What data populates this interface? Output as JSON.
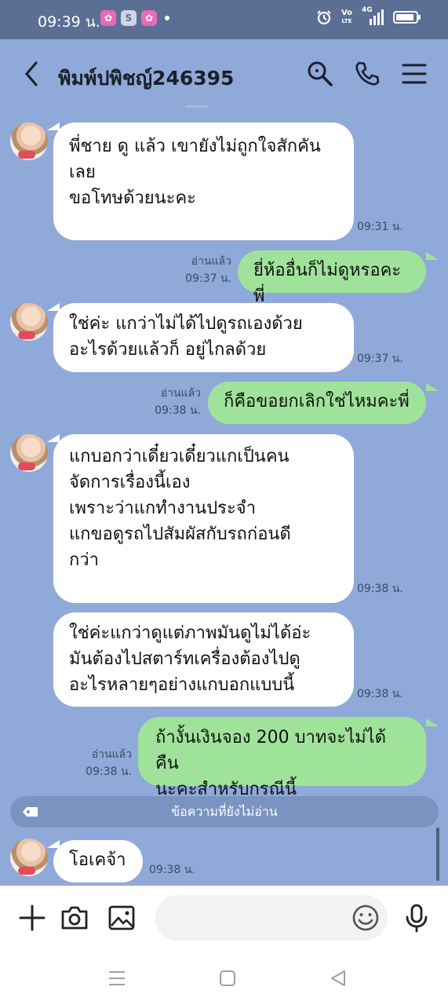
{
  "status": {
    "time": "09:39 น.",
    "app_icon_s": "S",
    "net_vo": "Vo",
    "net_lte": "LTE",
    "net_4g": "4G"
  },
  "header": {
    "title": "พิมพ์ปพิชญ์246395"
  },
  "messages": [
    {
      "dir": "in",
      "text": "พี่ชาย ดู แล้ว เขายังไม่ถูกใจสักคัน\nเลย\nขอโทษด้วยนะคะ",
      "time": "09:31 น."
    },
    {
      "dir": "out",
      "text": "ยี่ห้ออื่นก็ไม่ดูหรอคะพี่",
      "read": "อ่านแล้ว",
      "time": "09:37 น."
    },
    {
      "dir": "in",
      "text": "ใช่ค่ะ แกว่าไม่ได้ไปดูรถเองด้วย\nอะไรด้วยแล้วก็ อยู่ไกลด้วย",
      "time": "09:37 น."
    },
    {
      "dir": "out",
      "text": "ก็คือขอยกเลิกใช่ไหมคะพี่",
      "read": "อ่านแล้ว",
      "time": "09:38 น."
    },
    {
      "dir": "in",
      "text": "แกบอกว่าเดี๋ยวเดี๋ยวแกเป็นคน\nจัดการเรื่องนี้เอง\nเพราะว่าแกทำงานประจำ\nแกขอดูรถไปสัมผัสกับรถก่อนดี\nกว่า",
      "time": "09:38 น."
    },
    {
      "dir": "in",
      "text": "ใช่ค่ะแกว่าดูแต่ภาพมันดูไม่ได้อ่ะ\nมันต้องไปสตาร์ทเครื่องต้องไปดู\nอะไรหลายๆอย่างแกบอกแบบนี้",
      "time": "09:38 น."
    },
    {
      "dir": "out",
      "text": "ถ้างั้นเงินจอง 200 บาทจะไม่ได้คืน\nนะคะสำหรับกรณีนี้",
      "read": "อ่านแล้ว",
      "time": "09:38 น."
    },
    {
      "dir": "in",
      "text": "โอเคจ้า",
      "time": "09:38 น."
    }
  ],
  "unread_label": "ข้อความที่ยังไม่อ่าน",
  "input": {
    "placeholder": ""
  },
  "icons": {
    "back": "chevron-left-icon",
    "search": "search-icon",
    "call": "phone-icon",
    "menu": "menu-icon",
    "add": "plus-icon",
    "camera": "camera-icon",
    "image": "image-icon",
    "emoji": "emoji-icon",
    "mic": "microphone-icon"
  },
  "colors": {
    "background": "#8fa9d8",
    "outgoing": "#9fe39a",
    "incoming": "#ffffff",
    "status_bar": "#5a6f93"
  }
}
